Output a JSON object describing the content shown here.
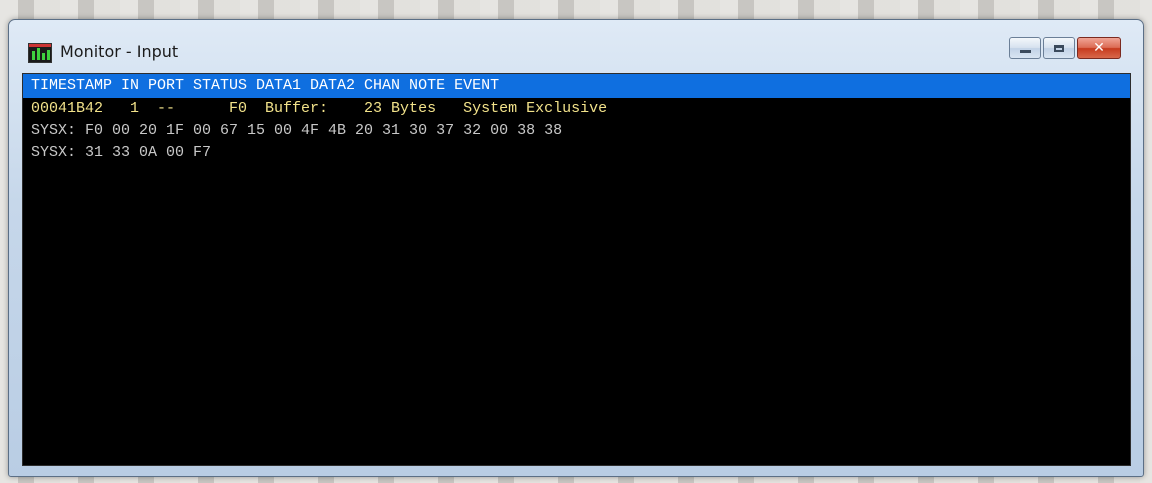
{
  "window": {
    "title": "Monitor - Input",
    "controls": {
      "minimize": "minimize",
      "maximize": "maximize",
      "close": "close"
    }
  },
  "monitor": {
    "header": "TIMESTAMP IN PORT STATUS DATA1 DATA2 CHAN NOTE EVENT",
    "lines": [
      {
        "kind": "event",
        "text": "00041B42   1  --      F0  Buffer:    23 Bytes   System Exclusive"
      },
      {
        "kind": "sysx",
        "text": "SYSX: F0 00 20 1F 00 67 15 00 4F 4B 20 31 30 37 32 00 38 38"
      },
      {
        "kind": "sysx",
        "text": "SYSX: 31 33 0A 00 F7"
      }
    ]
  },
  "colors": {
    "header_bg": "#0f6fe0",
    "event_text": "#f2e28a",
    "sysx_text": "#c8c8c8",
    "console_bg": "#000000"
  },
  "icons": {
    "app": "midi-monitor-icon",
    "close": "close-icon",
    "minimize": "minimize-icon",
    "maximize": "maximize-icon"
  }
}
